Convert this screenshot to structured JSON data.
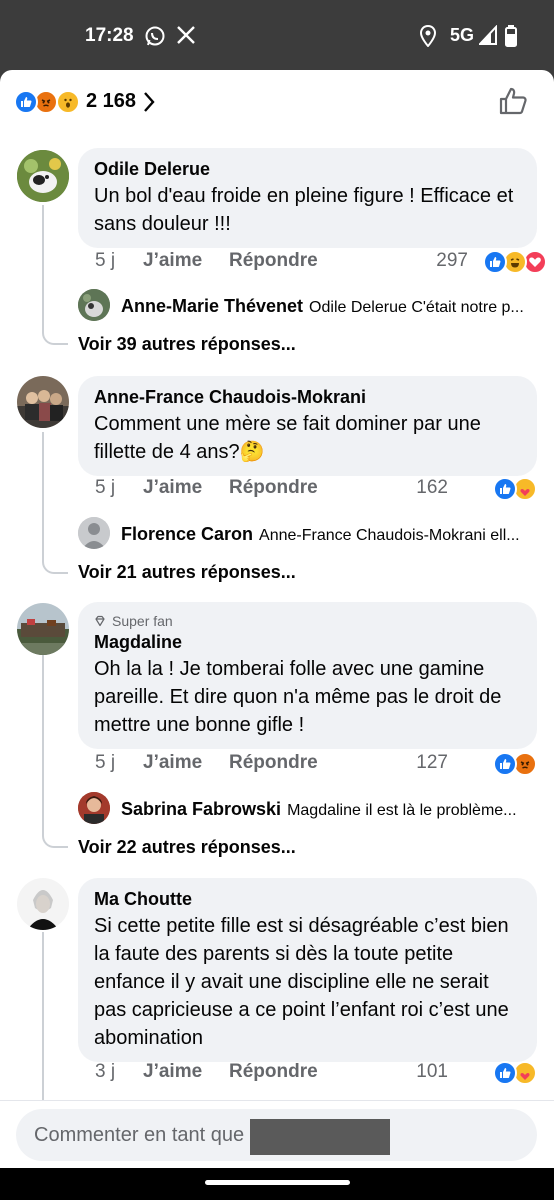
{
  "status_bar": {
    "time": "17:28",
    "network": "5G"
  },
  "header": {
    "reaction_count": "2 168"
  },
  "comments": [
    {
      "author": "Odile Delerue",
      "text": "Un bol d'eau froide en pleine figure ! Efficace et sans douleur !!!",
      "age": "5 j",
      "like_label": "J’aime",
      "reply_label": "Répondre",
      "reactions": "297",
      "reply": {
        "name": "Anne-Marie Thévenet",
        "text": "Odile Delerue C'était notre p..."
      },
      "more": "Voir 39 autres réponses..."
    },
    {
      "author": "Anne-France Chaudois-Mokrani",
      "text": "Comment une mère se fait dominer par une fillette de 4 ans?🤔",
      "age": "5 j",
      "like_label": "J’aime",
      "reply_label": "Répondre",
      "reactions": "162",
      "reply": {
        "name": "Florence Caron",
        "text": "Anne-France Chaudois-Mokrani ell..."
      },
      "more": "Voir 21 autres réponses..."
    },
    {
      "badge": "Super fan",
      "author": "Magdaline",
      "text": "Oh la la ! Je tomberai folle avec une gamine pareille. Et dire quon n'a même pas le droit de mettre une bonne gifle !",
      "age": "5 j",
      "like_label": "J’aime",
      "reply_label": "Répondre",
      "reactions": "127",
      "reply": {
        "name": "Sabrina Fabrowski",
        "text": "Magdaline  il est là le problème..."
      },
      "more": "Voir 22 autres réponses..."
    },
    {
      "author": "Ma Choutte",
      "text": "Si cette petite fille est si désagréable c’est bien la faute des parents si dès la toute petite enfance il y avait une discipline elle ne serait pas capricieuse a ce point l’enfant roi c’est une abomination",
      "age": "3 j",
      "like_label": "J’aime",
      "reply_label": "Répondre",
      "reactions": "101"
    }
  ],
  "composer": {
    "placeholder": "Commenter en tant que"
  },
  "colors": {
    "like_blue": "#1877f2",
    "love_red": "#f33e58",
    "haha_yellow": "#f7b928",
    "bubble_bg": "#f0f2f5"
  }
}
